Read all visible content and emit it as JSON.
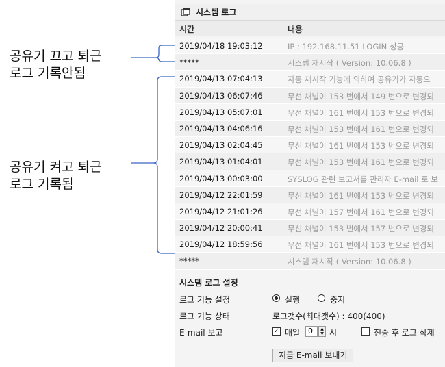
{
  "annotations": [
    {
      "line1": "공유기 끄고 퇴근",
      "line2": "로그 기록안됨"
    },
    {
      "line1": "공유기 켜고 퇴근",
      "line2": "로그 기록됨"
    }
  ],
  "panel": {
    "title": "시스템 로그",
    "columns": {
      "time": "시간",
      "content": "내용"
    },
    "rows": [
      {
        "time": "2019/04/18 19:03:12",
        "content": "IP : 192.168.11.51 LOGIN 성공"
      },
      {
        "time": "*****",
        "content": "시스템 재시작 ( Version: 10.06.8 )"
      },
      {
        "time": "2019/04/13 07:04:13",
        "content": "자동 재시작 기능에 의하여 공유기가 자동으"
      },
      {
        "time": "2019/04/13 06:07:46",
        "content": "무선 채널이 153 번에서 149 번으로 변경되"
      },
      {
        "time": "2019/04/13 05:07:01",
        "content": "무선 채널이 161 번에서 153 번으로 변경되"
      },
      {
        "time": "2019/04/13 04:06:16",
        "content": "무선 채널이 153 번에서 161 번으로 변경되"
      },
      {
        "time": "2019/04/13 02:04:45",
        "content": "무선 채널이 161 번에서 153 번으로 변경되"
      },
      {
        "time": "2019/04/13 01:04:01",
        "content": "무선 채널이 153 번에서 161 번으로 변경되"
      },
      {
        "time": "2019/04/13 00:03:00",
        "content": "SYSLOG 관련 보고서를 관리자 E-mail 로 보"
      },
      {
        "time": "2019/04/12 22:01:59",
        "content": "무선 채널이 161 번에서 153 번으로 변경되"
      },
      {
        "time": "2019/04/12 21:01:26",
        "content": "무선 채널이 157 번에서 161 번으로 변경되"
      },
      {
        "time": "2019/04/12 20:00:41",
        "content": "무선 채널이 153 번에서 157 번으로 변경되"
      },
      {
        "time": "2019/04/12 18:59:56",
        "content": "무선 채널이 161 번에서 153 번으로 변경되"
      },
      {
        "time": "*****",
        "content": "시스템 재시작 ( Version: 10.06.8 )"
      }
    ]
  },
  "settings": {
    "title": "시스템 로그 설정",
    "log_function_label": "로그 기능 설정",
    "run_option": "실행",
    "stop_option": "중지",
    "selected": "실행",
    "log_status_label": "로그 기능 상태",
    "log_status_value": "로그갯수(최대갯수) : 400(400)",
    "email_label": "E-mail 보고",
    "daily_label": "매일",
    "hour_value": "0",
    "hour_unit": "시",
    "delete_after_send_label": "전송 후 로그 삭제",
    "send_now_button": "지금 E-mail 보내기"
  }
}
